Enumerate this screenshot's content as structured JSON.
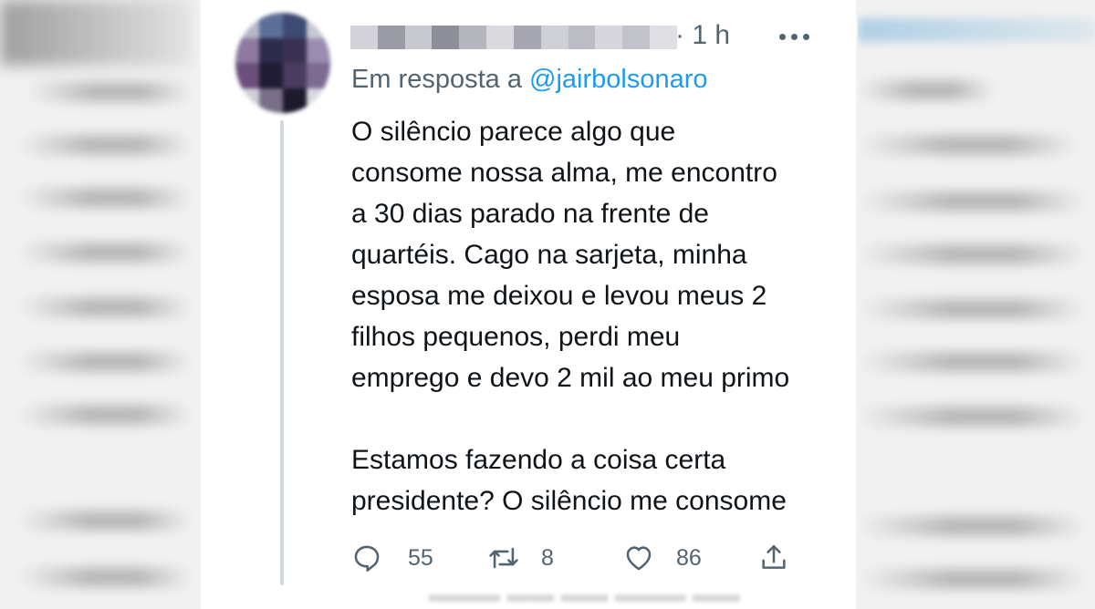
{
  "tweet": {
    "time": "1 h",
    "reply_prefix": "Em resposta a",
    "reply_handle": "@jairbolsonaro",
    "paragraph1": [
      "O silêncio parece algo que",
      "consome nossa alma, me encontro",
      "a 30 dias parado na frente de",
      "quartéis. Cago na sarjeta, minha",
      "esposa me deixou e levou meus 2",
      "filhos pequenos, perdi meu",
      "emprego e devo 2 mil ao meu primo"
    ],
    "paragraph2": [
      "Estamos fazendo a coisa certa",
      "presidente? O silêncio me consome"
    ],
    "actions": {
      "reply_icon": "reply-icon",
      "reply_count": "55",
      "retweet_icon": "retweet-icon",
      "retweet_count": "8",
      "like_icon": "like-icon",
      "like_count": "86",
      "share_icon": "share-icon"
    }
  },
  "colors": {
    "text": "#0f1419",
    "secondary": "#536471",
    "link": "#1d9bf0",
    "thread_line": "#cfd9de"
  }
}
